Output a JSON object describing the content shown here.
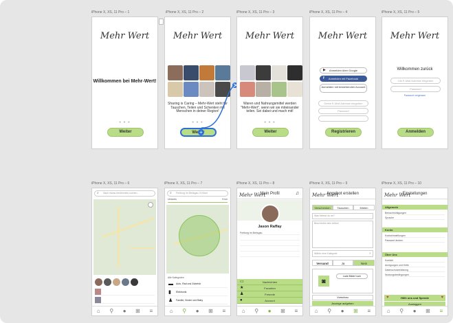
{
  "frame_labels": [
    "iPhone X, XS, 11 Pro – 1",
    "iPhone X, XS, 11 Pro – 2",
    "iPhone X, XS, 11 Pro – 3",
    "iPhone X, XS, 11 Pro – 4",
    "iPhone X, XS, 11 Pro – 5",
    "iPhone X, XS, 11 Pro – 6",
    "iPhone X, XS, 11 Pro – 7",
    "iPhone X, XS, 11 Pro – 8",
    "iPhone X, XS, 11 Pro – 9",
    "iPhone X, XS, 11 Pro – 10"
  ],
  "logo": "Mehr Wert",
  "screen1": {
    "welcome": "Willkommen bei Mehr-Wert!",
    "button": "Weiter"
  },
  "screen2": {
    "text": "Sharing is Caring – Mehr-Wert steht für Tauschen, Teilen und Schenken mit Menschen in deiner Region!",
    "button": "Weiter"
  },
  "screen3": {
    "text": "Waren und Nahrungsmittel werden \"Mehr-Wert\", wenn wir sie miteinander teilen. Sei dabei und mach mit!",
    "button": "Weiter"
  },
  "screen4": {
    "google": "Anmelden über Google",
    "facebook": "Anmelden mit Facebook",
    "account": "Anmelden mit bestehenden Account",
    "email_placeholder": "Deine E-Mail Adresse eingeben",
    "password_placeholder": "Passwort",
    "button": "Registrieren"
  },
  "screen5": {
    "title": "Willkommen zurück",
    "email_placeholder": "Gib E-Mail Adresse eingeben",
    "password_placeholder": "Passwort",
    "forgot": "Passwort vergessen",
    "button": "Anmelden"
  },
  "screen6": {
    "search_placeholder": "Nach etwas bestimmtes suchen..."
  },
  "screen7": {
    "search_placeholder": "Freiburg im Breisgau, 5 Kilom",
    "umkreis": "Umkreis",
    "km": "5 km",
    "categories_title": "Alle Kategorien",
    "categories": [
      "Auto, Rad und Zubehör",
      "Elektronik",
      "Familie, Kinder und Baby"
    ]
  },
  "screen8": {
    "title": "Mein Profil",
    "name": "Jason Raffay",
    "location": "Freiburg im Breisgau",
    "menu": [
      "Nachrichten",
      "Favoriten",
      "Freunde",
      "Account"
    ]
  },
  "screen9": {
    "title": "Angebot erstellen",
    "tabs": [
      "Verschenken",
      "Tauschen",
      "Mieten"
    ],
    "title_placeholder": "Was bietest du an?",
    "desc_placeholder": "Beschreibe dein Artikel",
    "category": "Wähle eine Kategorie",
    "delivery": [
      "Versand",
      "Ja",
      "Nein"
    ],
    "upload": "Lade Bilder hoch",
    "preview": "Vorschau",
    "submit": "Anzeige aufgeben"
  },
  "screen10": {
    "title": "Einstellungen",
    "sections": [
      "Allgemein",
      "Konto",
      "Über Uns"
    ],
    "general": [
      "Benachrichtigungen",
      "Sprache"
    ],
    "account": [
      "Kontoeinstellungen",
      "Passwort ändern"
    ],
    "about": [
      "Kontakt",
      "Anregungen und Kritik",
      "Datenschutzerklärung",
      "Nutzungsbedingungen"
    ],
    "help": "Hilfe uns und Spende",
    "logout": "Ausloggen"
  },
  "colors": {
    "accent": "#b9dd86",
    "accent_border": "#9fc468",
    "link": "#4a78c2",
    "facebook": "#3b5998",
    "proto_link": "#2d6fd6",
    "heart": "#d93a3a"
  }
}
